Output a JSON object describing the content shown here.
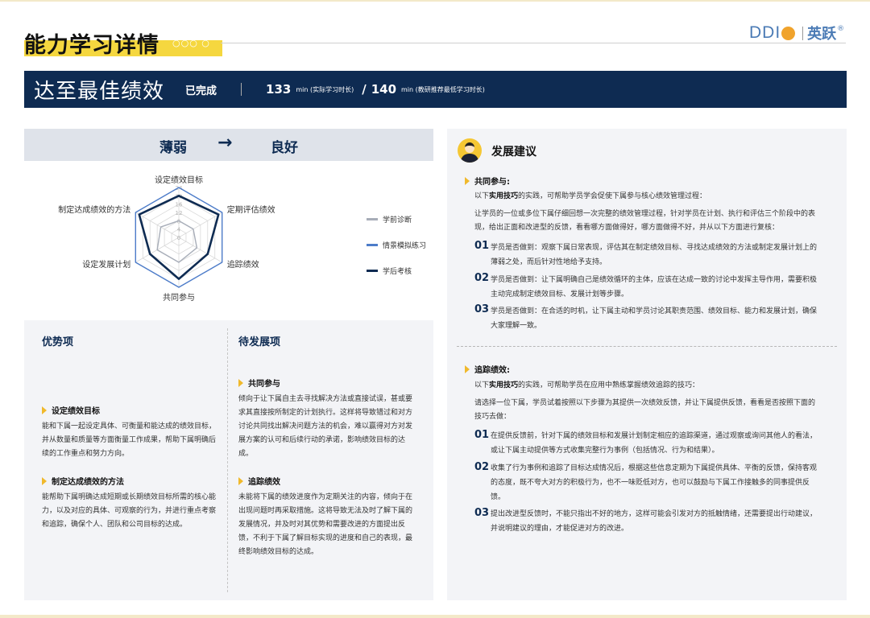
{
  "header": {
    "title": "能力学习详情",
    "dots": "○○○ ○",
    "logo_ddi": "DDI",
    "logo_cn": "英跃",
    "logo_reg": "®"
  },
  "banner": {
    "title": "达至最佳绩效",
    "status": "已完成",
    "actual_minutes": "133",
    "actual_unit": "min (实际学习时长)",
    "slash": "/",
    "recommended_minutes": "140",
    "recommended_unit": "min (教研推荐最低学习时长)"
  },
  "level": {
    "from": "薄弱",
    "arrow": "→",
    "to": "良好"
  },
  "radar": {
    "axes": [
      "设定绩效目标",
      "定期评估绩效",
      "追踪绩效",
      "共同参与",
      "设定发展计划",
      "制定达成绩效的方法"
    ],
    "ticks": [
      "24",
      "20",
      "16",
      "12",
      "8",
      "4",
      "0"
    ],
    "max": 24,
    "series": [
      {
        "name": "学前诊断",
        "color": "#a7adb8",
        "values": [
          8,
          8,
          10,
          12,
          12,
          10
        ]
      },
      {
        "name": "情景模拟练习",
        "color": "#4d7cc9",
        "values": [
          24,
          24,
          24,
          24,
          24,
          24
        ]
      },
      {
        "name": "学后考核",
        "color": "#0e2b52",
        "values": [
          20,
          22,
          16,
          20,
          16,
          22
        ]
      }
    ]
  },
  "strengths": {
    "heading": "优势项",
    "items": [
      {
        "title": "设定绩效目标",
        "text": "能和下属一起设定具体、可衡量和能达成的绩效目标，并从数量和质量等方面衡量工作成果，帮助下属明确后续的工作重点和努力方向。"
      },
      {
        "title": "制定达成绩效的方法",
        "text": "能帮助下属明确达成短期或长期绩效目标所需的核心能力，以及对应的具体、可观察的行为，并进行重点考察和追踪，确保个人、团队和公司目标的达成。"
      }
    ]
  },
  "weaknesses": {
    "heading": "待发展项",
    "items": [
      {
        "title": "共同参与",
        "text": "倾向于让下属自主去寻找解决方法或直接试误，甚或要求其直接按所制定的计划执行。这样将导致错过和对方讨论共同找出解决问题方法的机会，难以赢得对方对发展方案的认可和后续行动的承诺，影响绩效目标的达成。"
      },
      {
        "title": "追踪绩效",
        "text": "未能将下属的绩效进度作为定期关注的内容，倾向于在出现问题时再采取措施。这将导致无法及时了解下属的发展情况，并及时对其优势和需要改进的方面提出反馈，不利于下属了解目标实现的进度和自己的表现，最终影响绩效目标的达成。"
      }
    ]
  },
  "advice": {
    "title": "发展建议",
    "sections": [
      {
        "title": "共同参与:",
        "intro_prefix": "以下",
        "intro_bold": "实用技巧",
        "intro_suffix": "的实践，可帮助学员学会促使下属参与核心绩效管理过程：",
        "text": "让学员的一位或多位下属仔细回想一次完整的绩效管理过程，针对学员在计划、执行和评估三个阶段中的表现，给出正面和改进型的反馈，看看哪方面做得好，哪方面做得不好，并从以下方面进行复核：",
        "points": [
          {
            "num": "01",
            "text": "学员是否做到：观察下属日常表现，评估其在制定绩效目标、寻找达成绩效的方法或制定发展计划上的薄弱之处，而后针对性地给予支持。"
          },
          {
            "num": "02",
            "text": "学员是否做到：让下属明确自己是绩效循环的主体，应该在达成一致的讨论中发挥主导作用，需要积极主动完成制定绩效目标、发展计划等步骤。"
          },
          {
            "num": "03",
            "text": "学员是否做到：在合适的时机，让下属主动和学员讨论其职责范围、绩效目标、能力和发展计划，确保大家理解一致。"
          }
        ]
      },
      {
        "title": "追踪绩效:",
        "intro_prefix": "以下",
        "intro_bold": "实用技巧",
        "intro_suffix": "的实践，可帮助学员在应用中熟练掌握绩效追踪的技巧：",
        "text": "请选择一位下属，学员试着按照以下步骤为其提供一次绩效反馈，并让下属提供反馈，看看是否按照下面的技巧去做：",
        "points": [
          {
            "num": "01",
            "text": "在提供反馈前，针对下属的绩效目标和发展计划制定相应的追踪渠道，通过观察或询问其他人的看法，或让下属主动提供等方式收集完整行为事例（包括情况、行为和结果）。"
          },
          {
            "num": "02",
            "text": "收集了行为事例和追踪了目标达成情况后，根据这些信息定期为下属提供具体、平衡的反馈，保持客观的态度，既不夸大对方的积极行为，也不一味贬低对方，也可以鼓励与下属工作接触多的同事提供反馈。"
          },
          {
            "num": "03",
            "text": "提出改进型反馈时，不能只指出不好的地方，这样可能会引发对方的抵触情绪，还需要提出行动建议，并说明建议的理由，才能促进对方的改进。"
          }
        ]
      }
    ]
  }
}
